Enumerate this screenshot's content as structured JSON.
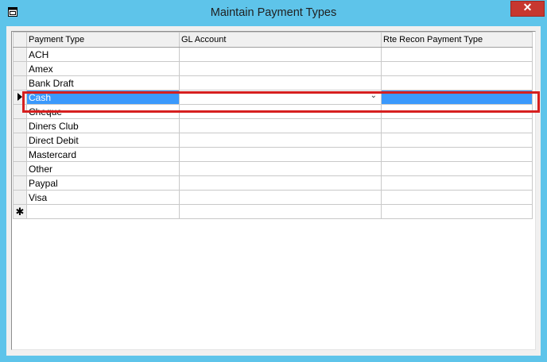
{
  "window": {
    "title": "Maintain Payment Types",
    "close_label": "✕"
  },
  "grid": {
    "columns": [
      "Payment Type",
      "GL Account",
      "Rte Recon Payment Type"
    ],
    "rows": [
      {
        "payment_type": "ACH",
        "gl_account": "",
        "rte": ""
      },
      {
        "payment_type": "Amex",
        "gl_account": "",
        "rte": ""
      },
      {
        "payment_type": "Bank Draft",
        "gl_account": "",
        "rte": ""
      },
      {
        "payment_type": "Cash",
        "gl_account": "",
        "rte": ""
      },
      {
        "payment_type": "Cheque",
        "gl_account": "",
        "rte": ""
      },
      {
        "payment_type": "Diners Club",
        "gl_account": "",
        "rte": ""
      },
      {
        "payment_type": "Direct Debit",
        "gl_account": "",
        "rte": ""
      },
      {
        "payment_type": "Mastercard",
        "gl_account": "",
        "rte": ""
      },
      {
        "payment_type": "Other",
        "gl_account": "",
        "rte": ""
      },
      {
        "payment_type": "Paypal",
        "gl_account": "",
        "rte": ""
      },
      {
        "payment_type": "Visa",
        "gl_account": "",
        "rte": ""
      }
    ],
    "current_row_index": 3,
    "new_row_marker": "✱",
    "combo_arrow": "⌄"
  }
}
